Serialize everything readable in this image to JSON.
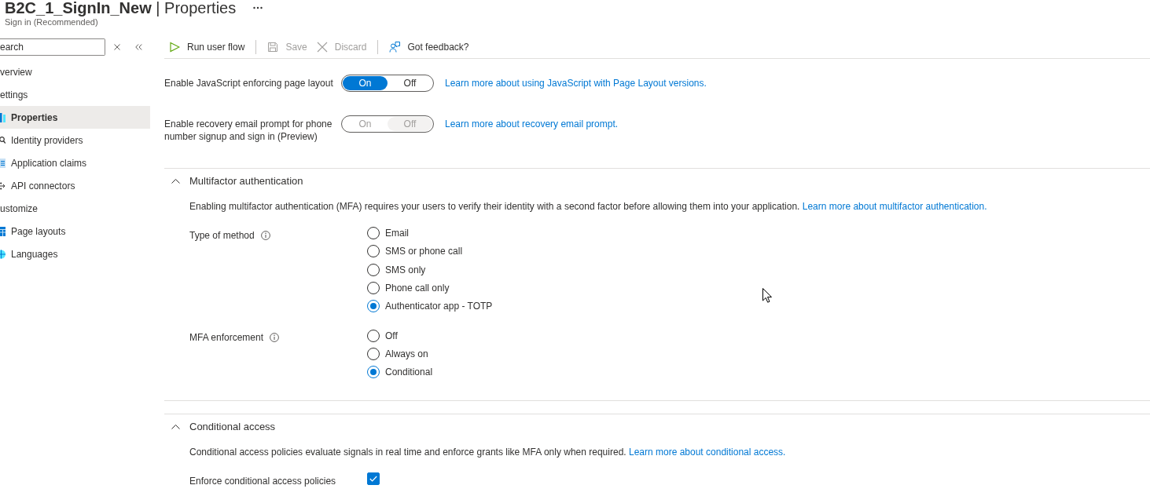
{
  "header": {
    "title": "**B2C_1_SignIn_New** | Properties",
    "subtitle": "Sign in (Recommended)"
  },
  "sidebar": {
    "search": {
      "placeholder": "earch"
    },
    "nav": [
      {
        "label": "verview",
        "selected": false
      },
      {
        "label": "ettings",
        "selected": false,
        "children": [
          {
            "label": "Properties",
            "selected": true
          },
          {
            "label": "Identity providers",
            "selected": false
          },
          {
            "label": "Application claims",
            "selected": false
          },
          {
            "label": "API connectors",
            "selected": false
          }
        ]
      },
      {
        "label": "ustomize",
        "selected": false,
        "children": [
          {
            "label": "Page layouts",
            "selected": false
          },
          {
            "label": "Languages",
            "selected": false
          }
        ]
      }
    ]
  },
  "toolbar": {
    "groups": [
      [
        {
          "label": "Run user flow",
          "disabled": false
        }
      ],
      [
        {
          "label": "Save",
          "disabled": true
        },
        {
          "label": "Discard",
          "disabled": true
        }
      ],
      [
        {
          "label": "Got feedback?",
          "disabled": false
        }
      ]
    ]
  },
  "settings": [
    {
      "label": "Enable JavaScript enforcing page layout",
      "disabled": false,
      "options": [
        {
          "label": "On",
          "selected": true
        },
        {
          "label": "Off",
          "selected": false
        }
      ],
      "link": "Learn more about using JavaScript with Page Layout versions."
    },
    {
      "label": "Enable recovery email prompt for phone number signup and sign in (Preview)",
      "disabled": true,
      "options": [
        {
          "label": "On",
          "selected": false
        },
        {
          "label": "Off",
          "selected": true
        }
      ],
      "link": "Learn more about recovery email prompt."
    }
  ],
  "sections": [
    {
      "title": "Multifactor authentication",
      "expanded": true,
      "description": "Enabling multifactor authentication (MFA) requires your users to verify their identity with a second factor before allowing them into your application.",
      "link": "Learn more about multifactor authentication.",
      "fields": [
        {
          "label": "Type of method",
          "kind": "radio",
          "info": true,
          "options": [
            {
              "label": "Email",
              "selected": false
            },
            {
              "label": "SMS or phone call",
              "selected": false
            },
            {
              "label": "SMS only",
              "selected": false
            },
            {
              "label": "Phone call only",
              "selected": false
            },
            {
              "label": "Authenticator app - TOTP",
              "selected": true
            }
          ]
        },
        {
          "label": "MFA enforcement",
          "kind": "radio",
          "info": true,
          "options": [
            {
              "label": "Off",
              "selected": false
            },
            {
              "label": "Always on",
              "selected": false
            },
            {
              "label": "Conditional",
              "selected": true
            }
          ]
        }
      ]
    },
    {
      "title": "Conditional access",
      "expanded": true,
      "description": "Conditional access policies evaluate signals in real time and enforce grants like MFA only when required.",
      "link": "Learn more about conditional access.",
      "fields": [
        {
          "label": "Enforce conditional access policies",
          "kind": "checkbox",
          "info": false,
          "checked": true
        }
      ]
    }
  ]
}
